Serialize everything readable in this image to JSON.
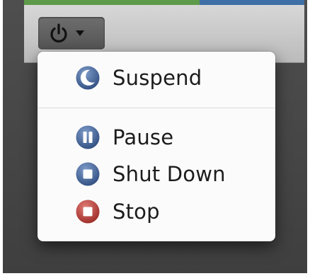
{
  "toolbar": {
    "power_menu_button": {
      "icon": "power-icon",
      "dropdown_icon": "chevron-down-icon"
    }
  },
  "colors": {
    "blue_icon": "#3f5f94",
    "red_icon": "#b23a35",
    "menu_background": "#fbfbfb",
    "text": "#1c1c1c"
  },
  "menu": {
    "items": [
      {
        "label": "Suspend",
        "icon": "moon-icon"
      },
      {
        "label": "Pause",
        "icon": "pause-icon"
      },
      {
        "label": "Shut Down",
        "icon": "stop-square-icon"
      },
      {
        "label": "Stop",
        "icon": "stop-square-icon"
      }
    ]
  }
}
